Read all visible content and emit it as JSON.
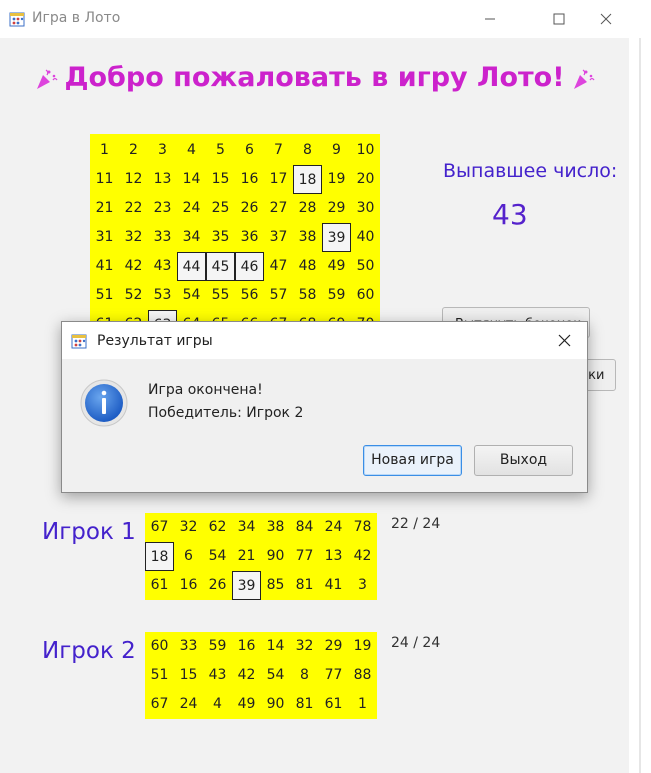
{
  "window": {
    "title": "Игра в Лото"
  },
  "heading": "Добро пожаловать в игру Лото!",
  "board": {
    "rows": [
      [
        "1",
        "2",
        "3",
        "4",
        "5",
        "6",
        "7",
        "8",
        "9",
        "10"
      ],
      [
        "11",
        "12",
        "13",
        "14",
        "15",
        "16",
        "17",
        "18",
        "19",
        "20"
      ],
      [
        "21",
        "22",
        "23",
        "24",
        "25",
        "26",
        "27",
        "28",
        "29",
        "30"
      ],
      [
        "31",
        "32",
        "33",
        "34",
        "35",
        "36",
        "37",
        "38",
        "39",
        "40"
      ],
      [
        "41",
        "42",
        "43",
        "44",
        "45",
        "46",
        "47",
        "48",
        "49",
        "50"
      ],
      [
        "51",
        "52",
        "53",
        "54",
        "55",
        "56",
        "57",
        "58",
        "59",
        "60"
      ],
      [
        "61",
        "62",
        "63",
        "64",
        "65",
        "66",
        "67",
        "68",
        "69",
        "70"
      ]
    ],
    "marked": [
      "18",
      "39",
      "44",
      "45",
      "46",
      "63"
    ]
  },
  "drawn": {
    "label": "Выпавшее число:",
    "number": "43"
  },
  "background_buttons": {
    "draw": "Вытянуть бочонок",
    "partial": "ски"
  },
  "players": [
    {
      "name": "Игрок 1",
      "score": "22 / 24",
      "rows": [
        [
          "67",
          "32",
          "62",
          "34",
          "38",
          "84",
          "24",
          "78"
        ],
        [
          "18",
          "6",
          "54",
          "21",
          "90",
          "77",
          "13",
          "42"
        ],
        [
          "61",
          "16",
          "26",
          "39",
          "85",
          "81",
          "41",
          "3"
        ]
      ],
      "marked": [
        "18",
        "39"
      ]
    },
    {
      "name": "Игрок 2",
      "score": "24 / 24",
      "rows": [
        [
          "60",
          "33",
          "59",
          "16",
          "14",
          "32",
          "29",
          "19"
        ],
        [
          "51",
          "15",
          "43",
          "42",
          "54",
          "8",
          "77",
          "88"
        ],
        [
          "67",
          "24",
          "4",
          "49",
          "90",
          "81",
          "61",
          "1"
        ]
      ],
      "marked": []
    }
  ],
  "dialog": {
    "title": "Результат игры",
    "message_line1": "Игра окончена!",
    "message_line2": "Победитель: Игрок 2",
    "new_game_label": "Новая игра",
    "exit_label": "Выход"
  },
  "colors": {
    "heading": "#cc22cc",
    "accent": "#4422cc",
    "card": "#ffff00",
    "info_icon": "#2a6fcf"
  },
  "icons": [
    "app-icon",
    "party-popper-icon",
    "minimize-icon",
    "maximize-icon",
    "close-icon",
    "info-icon"
  ]
}
